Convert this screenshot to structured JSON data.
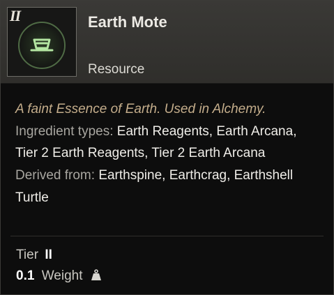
{
  "item": {
    "tier_badge": "II",
    "name": "Earth Mote",
    "type": "Resource",
    "icon": "earth-mote-icon",
    "flavor_text": "A faint Essence of Earth. Used in Alchemy.",
    "ingredient_types_label": "Ingredient types:",
    "ingredient_types_value": "Earth Reagents, Earth Arcana, Tier 2 Earth Reagents, Tier 2 Earth Arcana",
    "derived_from_label": "Derived from:",
    "derived_from_value": "Earthspine, Earthcrag, Earthshell Turtle",
    "tier_label": "Tier",
    "tier_value": "II",
    "weight_value": "0.1",
    "weight_label": "Weight",
    "weight_icon": "weight-icon"
  },
  "colors": {
    "flavor": "#c4ad8b",
    "icon_green": "#9fd48f",
    "header_bg": "#363532"
  }
}
